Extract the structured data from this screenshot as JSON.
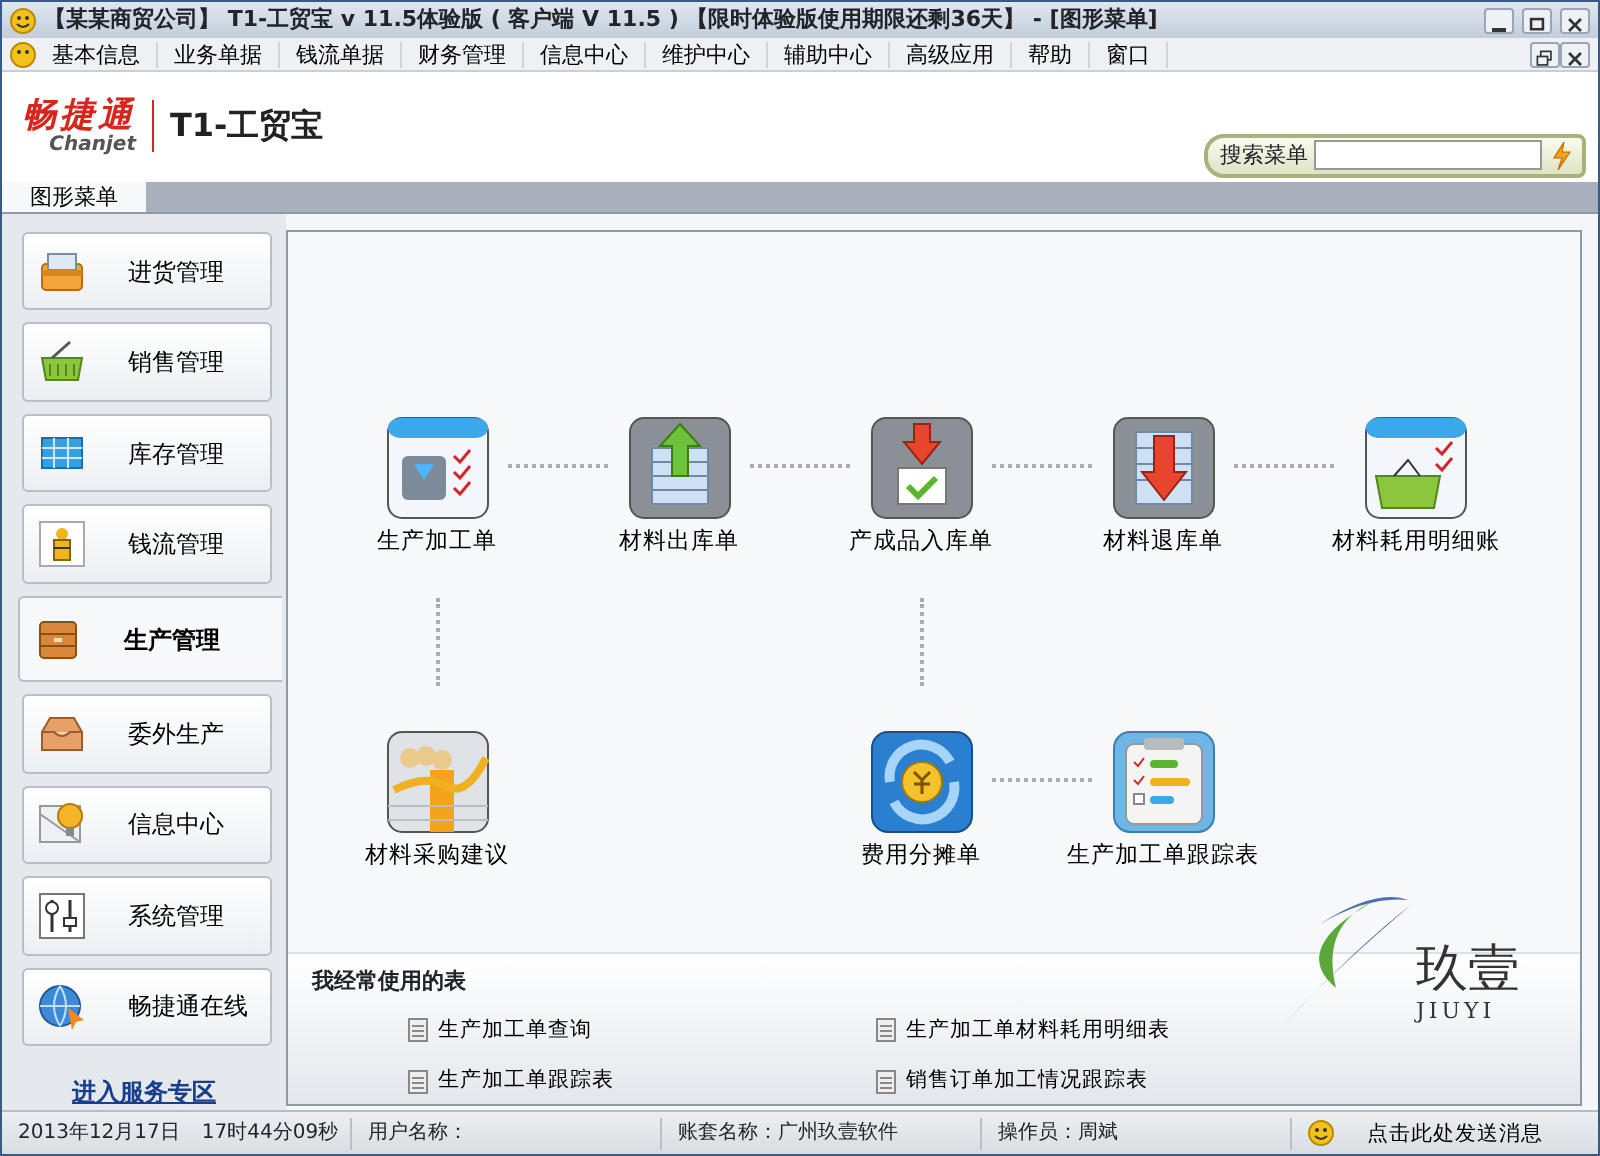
{
  "window": {
    "title": "【某某商贸公司】 T1-工贸宝 v 11.5体验版 ( 客户端 V 11.5 ) 【限时体验版使用期限还剩36天】 - [图形菜单]"
  },
  "menu": [
    "基本信息",
    "业务单据",
    "钱流单据",
    "财务管理",
    "信息中心",
    "维护中心",
    "辅助中心",
    "高级应用",
    "帮助",
    "窗口"
  ],
  "logo": {
    "brand": "畅捷通",
    "brand_latin": "Chanjet",
    "product": "T1-工贸宝"
  },
  "search": {
    "label": "搜索菜单"
  },
  "tabs": [
    {
      "label": "图形菜单",
      "selected": true
    }
  ],
  "sidebar": {
    "items": [
      {
        "label": "进货管理",
        "kind": "purchase",
        "selected": false
      },
      {
        "label": "销售管理",
        "kind": "sales",
        "selected": false
      },
      {
        "label": "库存管理",
        "kind": "stock",
        "selected": false
      },
      {
        "label": "钱流管理",
        "kind": "money",
        "selected": false
      },
      {
        "label": "生产管理",
        "kind": "production",
        "selected": true
      },
      {
        "label": "委外生产",
        "kind": "outsource",
        "selected": false
      },
      {
        "label": "信息中心",
        "kind": "info",
        "selected": false
      },
      {
        "label": "系统管理",
        "kind": "system",
        "selected": false
      },
      {
        "label": "畅捷通在线",
        "kind": "online",
        "selected": false
      }
    ],
    "link": "进入服务专区"
  },
  "diagram": {
    "rows": [
      [
        {
          "label": "生产加工单",
          "kind": "order"
        },
        {
          "label": "材料出库单",
          "kind": "stock-out"
        },
        {
          "label": "产成品入库单",
          "kind": "stock-in"
        },
        {
          "label": "材料退库单",
          "kind": "stock-return"
        },
        {
          "label": "材料耗用明细账",
          "kind": "ledger"
        }
      ],
      [
        {
          "label": "材料采购建议",
          "kind": "advice"
        },
        null,
        {
          "label": "费用分摊单",
          "kind": "cost"
        },
        {
          "label": "生产加工单跟踪表",
          "kind": "tracking"
        },
        null
      ]
    ]
  },
  "frequent": {
    "title": "我经常使用的表",
    "items": [
      "生产加工单查询",
      "生产加工单材料耗用明细表",
      "生产加工单跟踪表",
      "销售订单加工情况跟踪表"
    ]
  },
  "watermark_logo": {
    "text": "玖壹",
    "latin": "JIUYI"
  },
  "status_bar": {
    "date": "2013年12月17日",
    "time": "17时44分09秒",
    "user": "用户名称：",
    "account": "账套名称：广州玖壹软件",
    "operator": "操作员：周斌",
    "message": "点击此处发送消息"
  }
}
